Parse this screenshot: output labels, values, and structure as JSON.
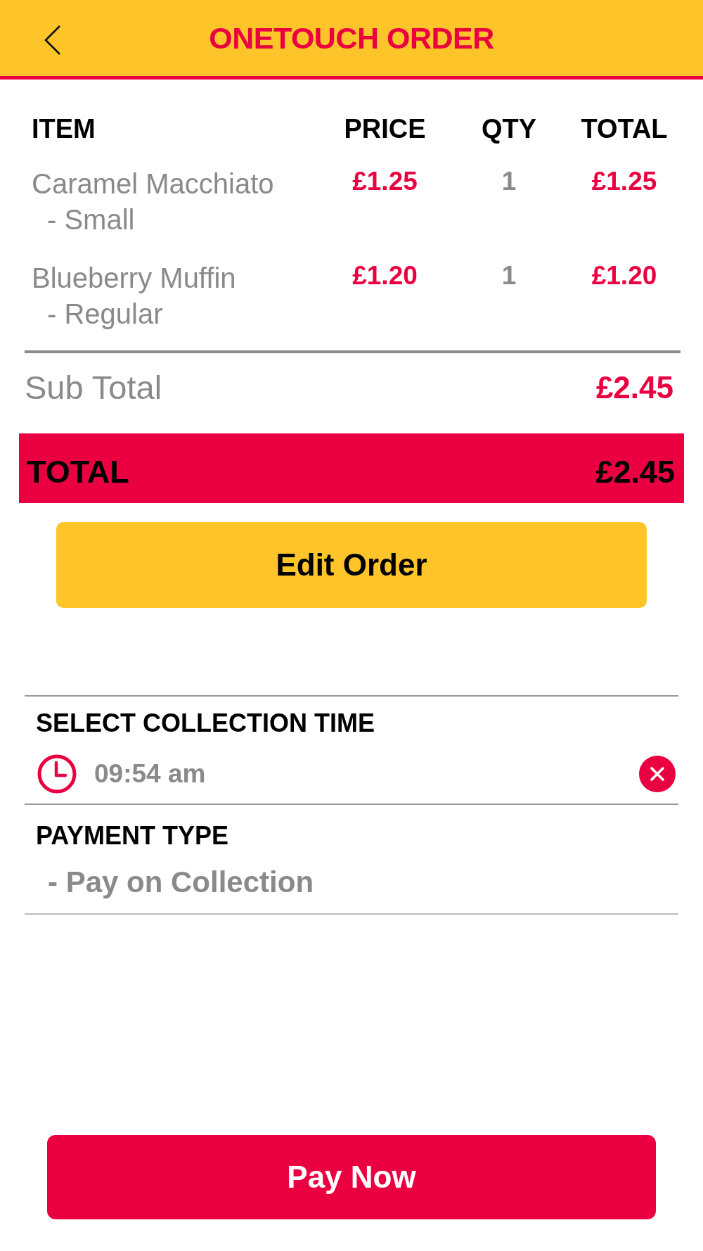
{
  "header": {
    "title": "ONETOUCH ORDER"
  },
  "order_table": {
    "columns": [
      "ITEM",
      "PRICE",
      "QTY",
      "TOTAL"
    ],
    "rows": [
      {
        "name": "Caramel Macchiato",
        "option": "- Small",
        "price": "£1.25",
        "qty": "1",
        "total": "£1.25"
      },
      {
        "name": "Blueberry Muffin",
        "option": "- Regular",
        "price": "£1.20",
        "qty": "1",
        "total": "£1.20"
      }
    ]
  },
  "sub_total": {
    "label": "Sub Total",
    "value": "£2.45"
  },
  "total": {
    "label": "TOTAL",
    "value": "£2.45"
  },
  "edit_button": {
    "label": "Edit Order"
  },
  "collection_time": {
    "label": "SELECT COLLECTION TIME",
    "value": "09:54 am"
  },
  "payment_type": {
    "label": "PAYMENT TYPE",
    "value": "- Pay on Collection"
  },
  "pay_button": {
    "label": "Pay Now"
  }
}
